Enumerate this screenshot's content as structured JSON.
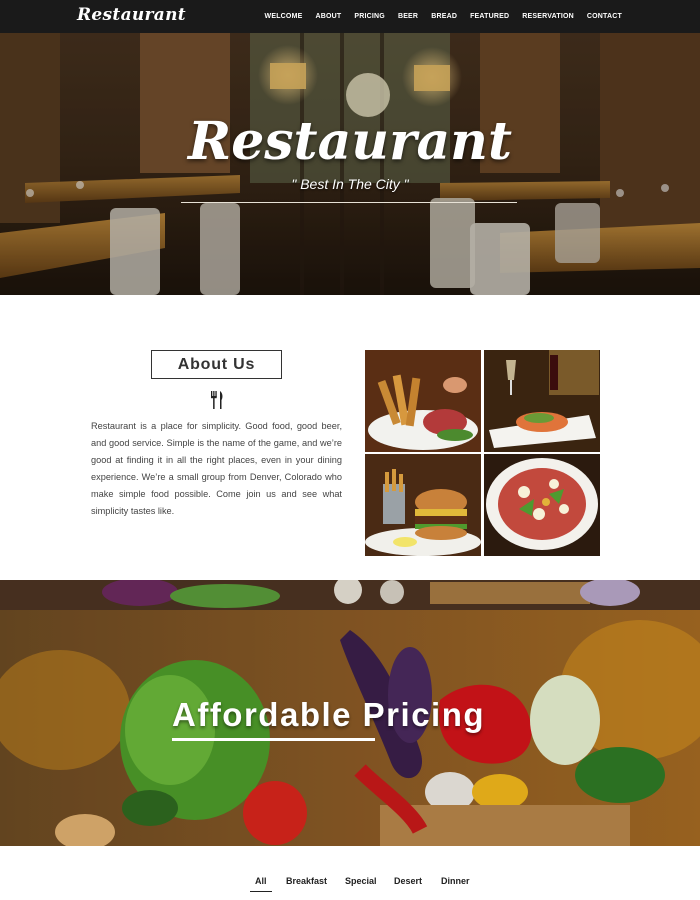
{
  "nav": {
    "logo": "Restaurant",
    "items": [
      "WELCOME",
      "ABOUT",
      "PRICING",
      "BEER",
      "BREAD",
      "FEATURED",
      "RESERVATION",
      "CONTACT"
    ]
  },
  "hero": {
    "title": "Restaurant",
    "subtitle": "\" Best In The City \""
  },
  "about": {
    "heading": "About Us",
    "icon": "fork-knife-icon",
    "text": "Restaurant is a place for simplicity. Good food, good beer, and good service. Simple is the name of the game, and we’re good at finding it in all the right places, even in your dining experience. We’re a small group from Denver, Colorado who make simple food possible. Come join us and see what simplicity tastes like."
  },
  "pricing": {
    "title": "Affordable Pricing"
  },
  "tabs": {
    "items": [
      "All",
      "Breakfast",
      "Special",
      "Desert",
      "Dinner"
    ],
    "active": "All"
  },
  "colors": {
    "nav_bg": "#1a1a1a",
    "hero_tint": "#2a1d12",
    "text": "#333333"
  }
}
